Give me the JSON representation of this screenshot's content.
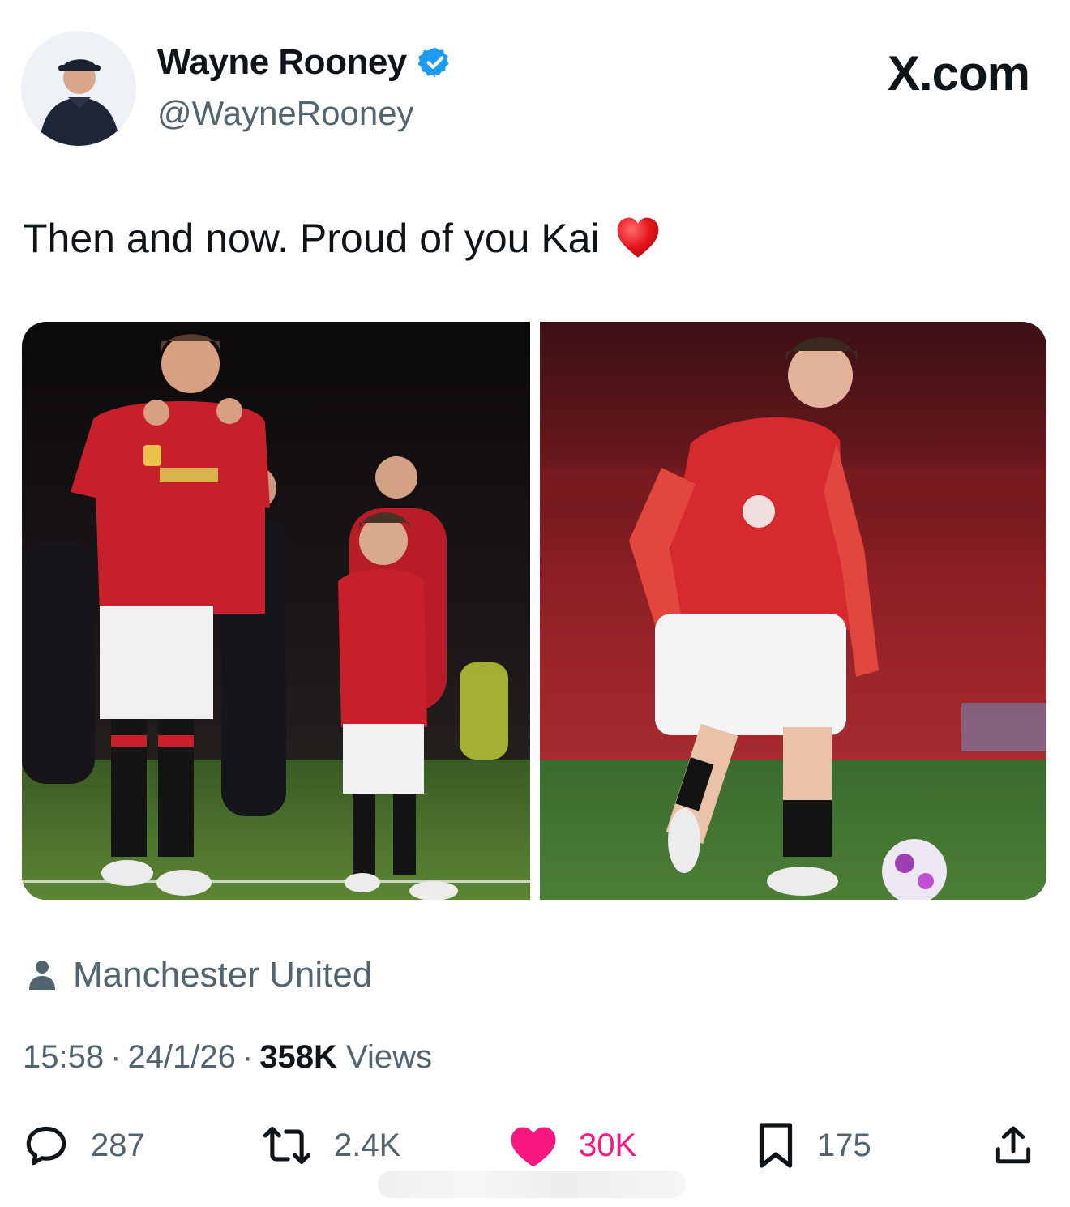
{
  "header": {
    "display_name": "Wayne Rooney",
    "handle": "@WayneRooney",
    "brand": "X.com",
    "verified": true,
    "verified_color": "#1d9bf0"
  },
  "tweet": {
    "text": "Then and now. Proud of you Kai",
    "emoji": "red-heart"
  },
  "media": {
    "count": 2,
    "items": [
      "then-photo",
      "now-photo"
    ]
  },
  "location": {
    "label": "Manchester United"
  },
  "meta": {
    "time": "15:58",
    "date": "24/1/26",
    "views_count": "358K",
    "views_label": "Views"
  },
  "actions": {
    "replies": "287",
    "retweets": "2.4K",
    "likes": "30K",
    "bookmarks": "175",
    "liked": true,
    "like_color": "#f91880"
  }
}
